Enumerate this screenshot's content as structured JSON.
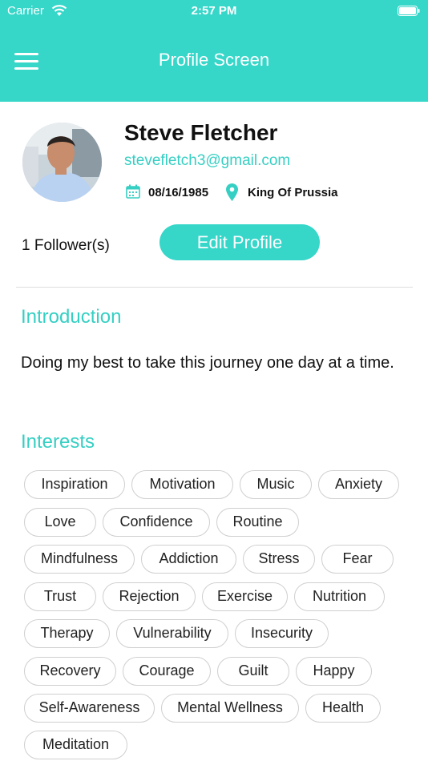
{
  "status_bar": {
    "carrier": "Carrier",
    "time": "2:57 PM"
  },
  "header": {
    "title": "Profile Screen"
  },
  "profile": {
    "name": "Steve Fletcher",
    "email": "stevefletch3@gmail.com",
    "dob": "08/16/1985",
    "location": "King Of Prussia",
    "followers": "1 Follower(s)",
    "edit_label": "Edit Profile"
  },
  "introduction": {
    "title": "Introduction",
    "text": "Doing my best to take this journey one day at a time."
  },
  "interests": {
    "title": "Interests",
    "items": [
      "Inspiration",
      "Motivation",
      "Music",
      "Anxiety",
      "Love",
      "Confidence",
      "Routine",
      "Mindfulness",
      "Addiction",
      "Stress",
      "Fear",
      "Trust",
      "Rejection",
      "Exercise",
      "Nutrition",
      "Therapy",
      "Vulnerability",
      "Insecurity",
      "Recovery",
      "Courage",
      "Guilt",
      "Happy",
      "Self-Awareness",
      "Mental Wellness",
      "Health",
      "Meditation"
    ]
  },
  "colors": {
    "accent": "#36d6c9",
    "accent_text": "#36cfc3"
  }
}
